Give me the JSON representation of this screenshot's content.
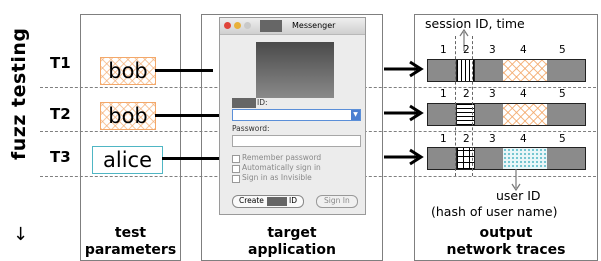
{
  "side_label": "fuzz testing",
  "side_arrow": "↓",
  "rows": [
    {
      "id": "T1",
      "value": "bob"
    },
    {
      "id": "T2",
      "value": "bob"
    },
    {
      "id": "T3",
      "value": "alice"
    }
  ],
  "captions": {
    "params": [
      "test",
      "parameters"
    ],
    "app": [
      "target",
      "application"
    ],
    "traces": [
      "output",
      "network traces"
    ]
  },
  "messenger": {
    "title": "Messenger",
    "id_label": "ID:",
    "password_label": "Password:",
    "options": [
      "Remember password",
      "Automatically sign in",
      "Sign in as Invisible"
    ],
    "create_button": "Create",
    "create_button_suffix": "ID",
    "sign_in_button": "Sign In"
  },
  "segment_numbers": [
    "1",
    "2",
    "3",
    "4",
    "5"
  ],
  "annotations": {
    "session": "session ID, time",
    "user_line1": "user ID",
    "user_line2": "(hash of user name)"
  },
  "colors": {
    "hatch_orange": "#f3a86a",
    "teal": "#4fb6c4",
    "track_gray": "#8b8b8b"
  }
}
